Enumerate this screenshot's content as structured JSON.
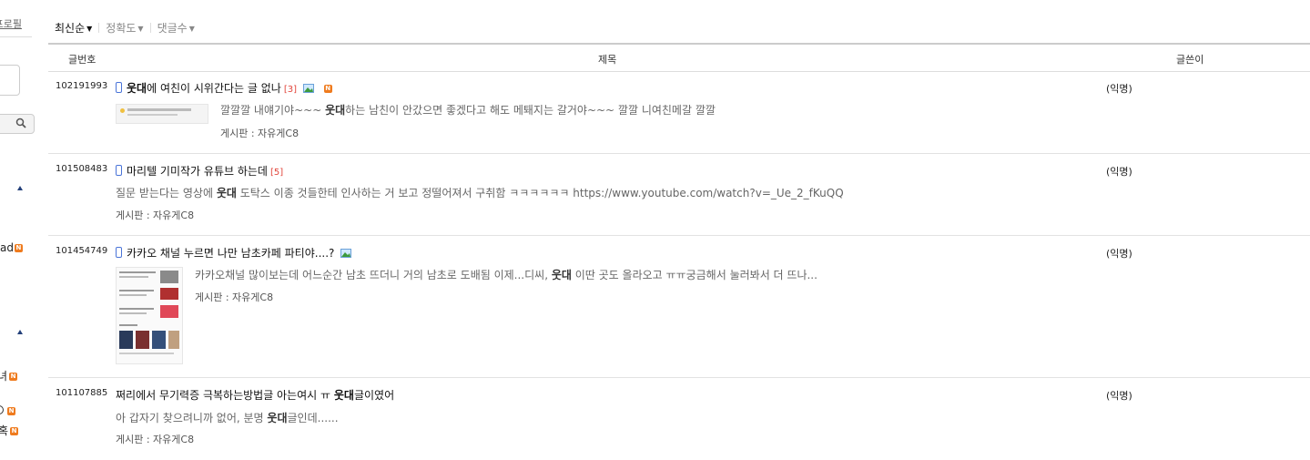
{
  "sidebar": {
    "profile_link": "프로필",
    "item_a": "ad",
    "item_b": "녀",
    "item_c": "혹"
  },
  "sort": {
    "options": [
      {
        "label": "최신순",
        "active": true
      },
      {
        "label": "정확도",
        "active": false
      },
      {
        "label": "댓글수",
        "active": false
      }
    ]
  },
  "table": {
    "headers": {
      "num": "글번호",
      "title": "제목",
      "author": "글쓴이"
    },
    "rows": [
      {
        "num": "102191993",
        "title_kw": "웃대",
        "title_rest": "에 여친이 시위간다는 글 없나",
        "comments": "[3]",
        "snippet_pre": "깔깔깔 내얘기야~~~ ",
        "snippet_kw": "웃대",
        "snippet_post": "하는 남친이 안갔으면 좋겠다고 해도 메퇘지는 갈거야~~~ 깔깔 니여친메갈 깔깔",
        "board": "게시판 : 자유게C8",
        "author": "(익명)"
      },
      {
        "num": "101508483",
        "title_rest": "마리텔 기미작가 유튜브 하는데",
        "comments": "[5]",
        "snippet_pre": "질문 받는다는 영상에 ",
        "snippet_kw": "웃대",
        "snippet_post": " 도탁스 이종 것들한테 인사하는 거 보고 정떨어져서 구취함 ㅋㅋㅋㅋㅋㅋ https://www.youtube.com/watch?v=_Ue_2_fKuQQ",
        "board": "게시판 : 자유게C8",
        "author": "(익명)"
      },
      {
        "num": "101454749",
        "title_rest": "카카오 채널 누르면 나만 남초카페 파티야....?",
        "snippet_pre": "카카오채널 많이보는데 어느순간 남초 뜨더니 거의 남초로 도배됨 이제...디씨, ",
        "snippet_kw": "웃대",
        "snippet_post": " 이딴 곳도 올라오고 ㅠㅠ궁금해서 눌러봐서 더 뜨나...",
        "board": "게시판 : 자유게C8",
        "author": "(익명)"
      },
      {
        "num": "101107885",
        "title_pre": "쩌리에서 무기력증 극복하는방법글 아는여시 ㅠ ",
        "title_kw": "웃대",
        "title_rest": "글이였어",
        "snippet_pre": "아 갑자기 찾으려니까 없어, 분명 ",
        "snippet_kw": "웃대",
        "snippet_post": "글인데......",
        "board": "게시판 : 자유게C8",
        "author": "(익명)"
      }
    ]
  },
  "icons": {
    "new_badge": "N",
    "phone": "phone-icon",
    "image": "image-icon",
    "search": "search-icon"
  },
  "colors": {
    "accent_blue": "#4a74d8",
    "comment_red": "#e2463c",
    "new_orange": "#ef7b1e"
  }
}
